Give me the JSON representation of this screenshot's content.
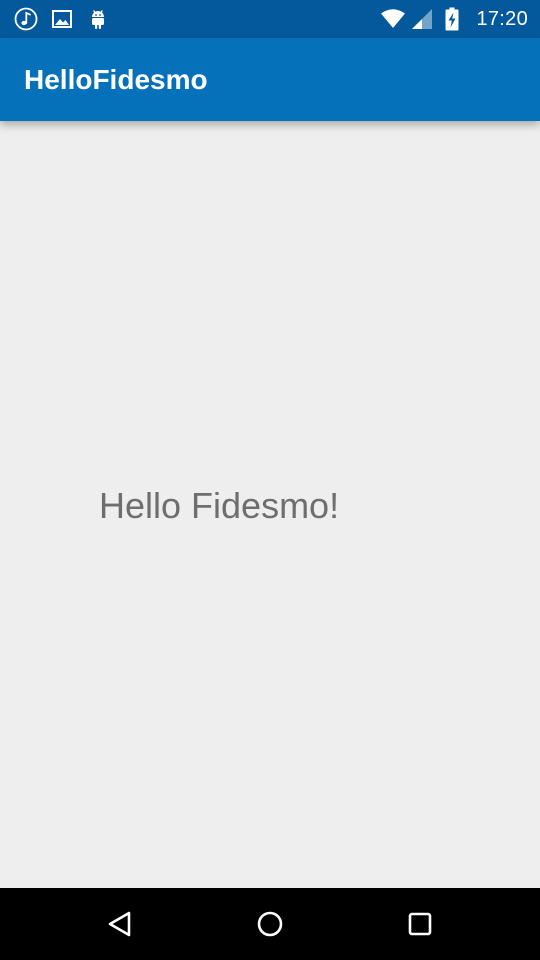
{
  "status_bar": {
    "background": "#04599c",
    "left_icons": [
      "music-note-icon",
      "image-icon",
      "android-icon"
    ],
    "right_icons": [
      "wifi-icon",
      "cellular-signal-icon",
      "battery-charging-icon"
    ],
    "time": "17:20"
  },
  "app_bar": {
    "title": "HelloFidesmo",
    "background": "#0571bb"
  },
  "content": {
    "message": "Hello Fidesmo!",
    "background": "#eeeeee",
    "text_color": "#6e6e6e"
  },
  "nav_bar": {
    "buttons": [
      "back-icon",
      "home-icon",
      "recents-icon"
    ],
    "background": "#000000"
  }
}
